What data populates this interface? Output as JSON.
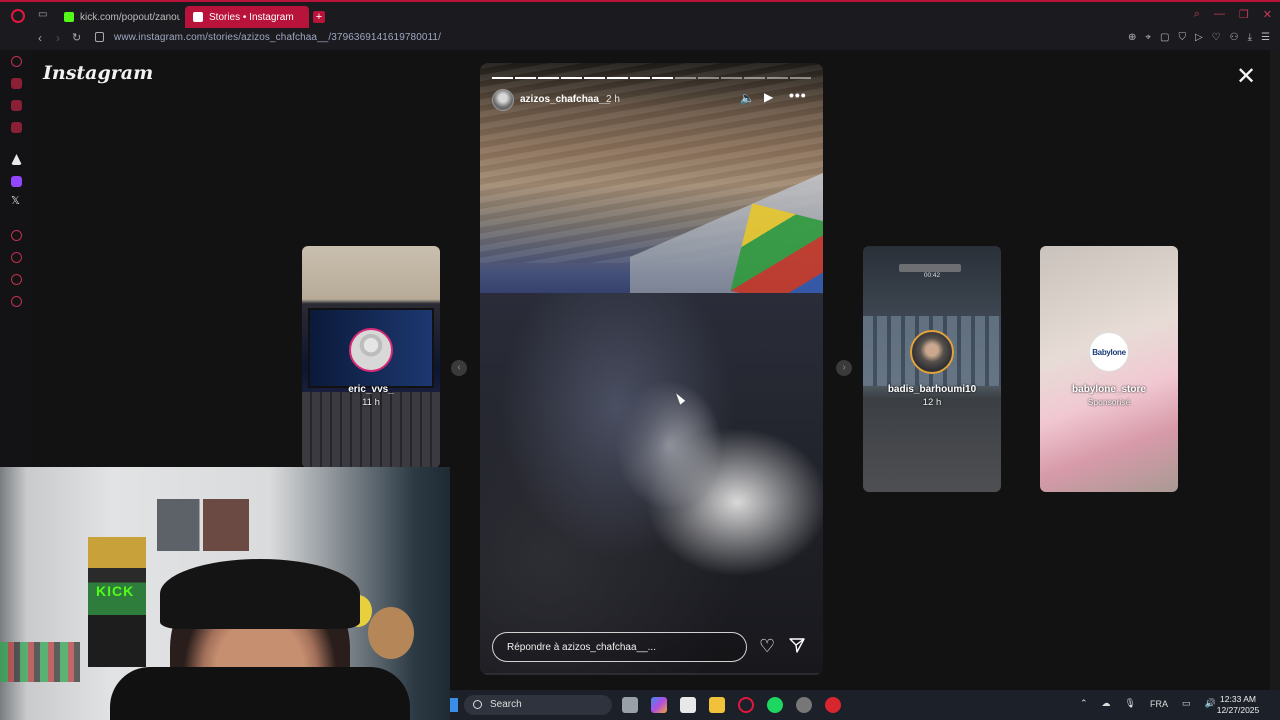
{
  "browser": {
    "tabs": [
      {
        "label": "kick.com/popout/zanoun",
        "active": false,
        "favicon_color": "#53fc18"
      },
      {
        "label": "Stories • Instagram",
        "active": true,
        "favicon_color": "#e1306c"
      }
    ],
    "new_tab": "+",
    "url": "www.instagram.com/stories/azizos_chafchaa__/3796369141619780011/",
    "accent": "#b8133a"
  },
  "instagram": {
    "logo": "Instagram",
    "close": "✕",
    "story": {
      "username": "azizos_chafchaa__",
      "time": "2 h",
      "reply_placeholder": "Répondre à azizos_chafchaa__...",
      "progress_total": 14,
      "progress_done": 8
    },
    "previews": [
      {
        "username": "eric_vvs_",
        "time": "11 h"
      },
      {
        "username": "badis_barhoumi10",
        "time": "12 h",
        "overlay_text": "00:42"
      },
      {
        "username": "babylone_store",
        "time": "Sponsorisé",
        "logo_text": "Babylone"
      }
    ]
  },
  "webcam": {
    "sign": "KICK"
  },
  "taskbar": {
    "search": "Search",
    "language": "FRA",
    "time": "12:33 AM",
    "date": "12/27/2025"
  }
}
